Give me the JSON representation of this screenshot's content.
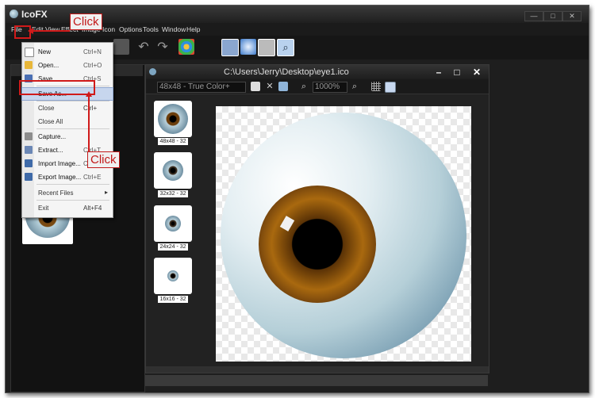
{
  "app_title": "IcoFX",
  "window_buttons": [
    "—",
    "□",
    "✕"
  ],
  "menubar": [
    "File",
    "Edit",
    "View",
    "Effect",
    "Image",
    "Icon",
    "Options",
    "Tools",
    "Window",
    "Help"
  ],
  "document": {
    "title": "C:\\Users\\Jerry\\Desktop\\eye1.ico",
    "format": "48x48 - True Color+",
    "zoom": "1000%"
  },
  "thumbnails": [
    "48x48 - 32",
    "32x32 - 32",
    "24x24 - 32",
    "16x16 - 32"
  ],
  "file_menu": [
    {
      "label": "New",
      "shortcut": "Ctrl+N",
      "icon": "new-file-icon"
    },
    {
      "label": "Open...",
      "shortcut": "Ctrl+O",
      "icon": "open-folder-icon"
    },
    {
      "label": "Save",
      "shortcut": "Ctrl+S",
      "icon": "save-icon"
    },
    {
      "label": "Save As...",
      "shortcut": "",
      "icon": ""
    },
    {
      "label": "Close",
      "shortcut": "Ctrl+",
      "icon": ""
    },
    {
      "label": "Close All",
      "shortcut": "",
      "icon": ""
    },
    {
      "label": "Capture...",
      "shortcut": "",
      "icon": "capture-icon"
    },
    {
      "label": "Extract...",
      "shortcut": "Ctrl+T",
      "icon": "extract-icon"
    },
    {
      "label": "Import Image...",
      "shortcut": "Ctrl",
      "icon": "import-image-icon"
    },
    {
      "label": "Export Image...",
      "shortcut": "Ctrl+E",
      "icon": "export-image-icon"
    },
    {
      "label": "Recent Files",
      "shortcut": "",
      "icon": ""
    },
    {
      "label": "Exit",
      "shortcut": "Alt+F4",
      "icon": ""
    }
  ],
  "callouts": [
    "Click",
    "Click"
  ],
  "colors": {
    "callout_red": "#d01a1a",
    "menu_highlight": "#c7d6ee",
    "app_dark": "#1e1e1e"
  }
}
